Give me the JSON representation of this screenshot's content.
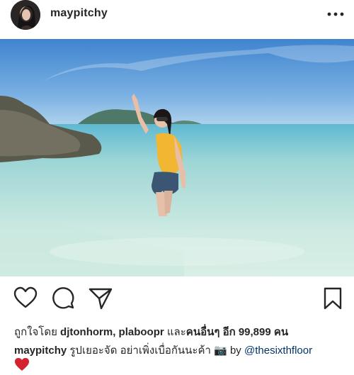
{
  "post": {
    "username": "maypitchy",
    "more_icon": "more-horizontal-icon"
  },
  "actions": {
    "like_icon": "heart-outline-icon",
    "comment_icon": "comment-bubble-icon",
    "share_icon": "paper-plane-icon",
    "save_icon": "bookmark-icon"
  },
  "likes": {
    "prefix": "ถูกใจโดย ",
    "users": "djtonhorm, plaboopr",
    "middle": " และ",
    "others": "คนอื่นๆ อีก 99,899 คน"
  },
  "caption": {
    "username": "maypitchy",
    "text": " รูปเยอะจัด อย่าเพิ่งเบื่อกันนะค้า 📷 by ",
    "mention": "@thesixthfloor",
    "emoji": "red-heart-emoji"
  },
  "colors": {
    "text": "#262626",
    "mention": "#003569",
    "sea": "#bfe3dc",
    "sky": "#4a8fd4"
  }
}
